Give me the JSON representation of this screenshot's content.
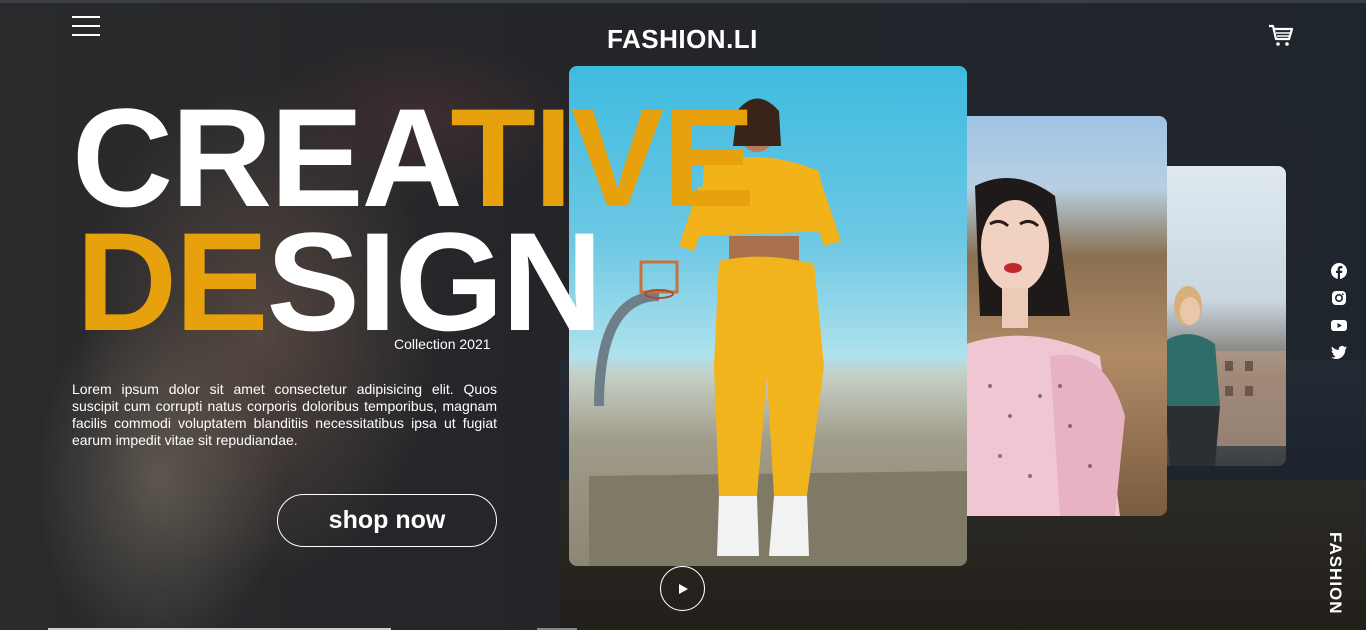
{
  "header": {
    "brand": "FASHION.LI",
    "menu_icon": "hamburger-menu-icon",
    "cart_icon": "shopping-cart-icon"
  },
  "hero": {
    "line1_white": "CREA",
    "line1_yellow": "TIVE",
    "line2_yellow": "DE",
    "line2_white": "SIGN",
    "collection": "Collection 2021",
    "description": "Lorem ipsum dolor sit amet consectetur adipisicing elit. Quos suscipit cum corrupti natus corporis doloribus temporibus, magnam facilis commodi voluptatem blanditiis necessitatibus ipsa ut fugiat earum impedit vitae sit repudiandae.",
    "cta_label": "shop now"
  },
  "gallery": {
    "cards": [
      {
        "subject": "model in yellow tracksuit at basketball court"
      },
      {
        "subject": "model in pink ruffled dress in field"
      },
      {
        "subject": "model in city street"
      }
    ],
    "play_icon": "play-icon"
  },
  "social": {
    "icons": [
      "facebook-icon",
      "instagram-icon",
      "youtube-icon",
      "twitter-icon"
    ]
  },
  "side_label": "FASHION",
  "colors": {
    "accent": "#e6a10c",
    "background": "#1f242b",
    "text": "#ffffff"
  }
}
